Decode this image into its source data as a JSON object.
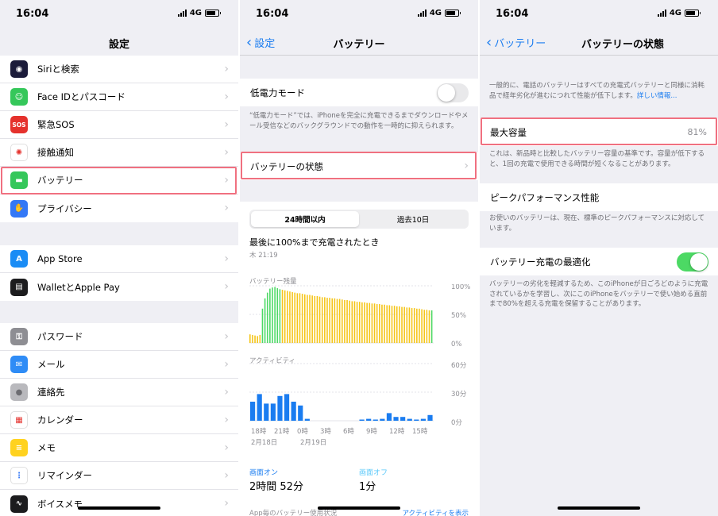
{
  "panel1": {
    "time": "16:04",
    "network": "4G",
    "title": "設定",
    "groups": [
      [
        {
          "label": "Siriと検索",
          "icon": "siri-icon",
          "color": "#1b1b3a"
        },
        {
          "label": "Face IDとパスコード",
          "icon": "face-id-icon",
          "color": "#35c75a"
        },
        {
          "label": "緊急SOS",
          "icon": "sos-icon",
          "color": "#e5322d",
          "glyph": "SOS"
        },
        {
          "label": "接触通知",
          "icon": "exposure-notification-icon",
          "color": "#ffffff"
        },
        {
          "label": "バッテリー",
          "icon": "battery-icon",
          "color": "#35c75a"
        },
        {
          "label": "プライバシー",
          "icon": "hand-icon",
          "color": "#3478f6"
        }
      ],
      [
        {
          "label": "App Store",
          "icon": "app-store-icon",
          "color": "#1a8cf5"
        },
        {
          "label": "WalletとApple Pay",
          "icon": "wallet-icon",
          "color": "#1c1c1e"
        }
      ],
      [
        {
          "label": "パスワード",
          "icon": "key-icon",
          "color": "#8e8e93"
        },
        {
          "label": "メール",
          "icon": "mail-icon",
          "color": "#2f8cf6"
        },
        {
          "label": "連絡先",
          "icon": "contacts-icon",
          "color": "#b9b9bd"
        },
        {
          "label": "カレンダー",
          "icon": "calendar-icon",
          "color": "#ffffff"
        },
        {
          "label": "メモ",
          "icon": "notes-icon",
          "color": "#ffd21f"
        },
        {
          "label": "リマインダー",
          "icon": "reminders-icon",
          "color": "#ffffff"
        },
        {
          "label": "ボイスメモ",
          "icon": "voice-memos-icon",
          "color": "#1c1c1e"
        }
      ]
    ]
  },
  "panel2": {
    "time": "16:04",
    "network": "4G",
    "back": "設定",
    "title": "バッテリー",
    "low_power_label": "低電力モード",
    "low_power_on": false,
    "low_power_note": "“低電力モード”では、iPhoneを完全に充電できるまでダウンロードやメール受信などのバックグラウンドでの動作を一時的に抑えられます。",
    "health_label": "バッテリーの状態",
    "tabs": [
      "24時間以内",
      "過去10日"
    ],
    "last_charge_title": "最後に100%まで充電されたとき",
    "last_charge_time": "木 21:19",
    "level_chart_label": "バッテリー残量",
    "level_ticks": [
      "100%",
      "50%",
      "0%"
    ],
    "activity_chart_label": "アクティビティ",
    "activity_ticks": [
      "60分",
      "30分",
      "0分"
    ],
    "hour_labels": [
      "18時",
      "21時",
      "0時",
      "3時",
      "6時",
      "9時",
      "12時",
      "15時"
    ],
    "date_labels": [
      "2月18日",
      "2月19日"
    ],
    "screen_on_label": "画面オン",
    "screen_on_value": "2時間 52分",
    "screen_off_label": "画面オフ",
    "screen_off_value": "1分",
    "app_usage_label": "App毎のバッテリー使用状況",
    "show_activity_link": "アクティビティを表示"
  },
  "panel3": {
    "time": "16:04",
    "network": "4G",
    "back": "バッテリー",
    "title": "バッテリーの状態",
    "intro": "一般的に、電話のバッテリーはすべての充電式バッテリーと同様に消耗品で経年劣化が進むにつれて性能が低下します。",
    "learn_more": "詳しい情報...",
    "max_capacity_label": "最大容量",
    "max_capacity_value": "81%",
    "max_capacity_note": "これは、新品時と比較したバッテリー容量の基準です。容量が低下すると、1回の充電で使用できる時間が短くなることがあります。",
    "peak_label": "ピークパフォーマンス性能",
    "peak_note": "お使いのバッテリーは、現在、標準のピークパフォーマンスに対応しています。",
    "optimized_label": "バッテリー充電の最適化",
    "optimized_on": true,
    "optimized_note": "バッテリーの劣化を軽減するため、このiPhoneが日ごろどのように充電されているかを学習し、次にこのiPhoneをバッテリーで使い始める直前まで80%を超える充電を保留することがあります。"
  },
  "chart_data": [
    {
      "type": "bar",
      "title": "バッテリー残量",
      "ylim": [
        0,
        100
      ],
      "y_ticks": [
        "100%",
        "50%",
        "0%"
      ],
      "values": [
        15,
        14,
        13,
        12,
        14,
        60,
        78,
        88,
        95,
        97,
        98,
        96,
        94,
        93,
        92,
        91,
        90,
        89,
        88,
        87,
        87,
        86,
        85,
        84,
        84,
        83,
        82,
        82,
        81,
        80,
        80,
        79,
        79,
        78,
        78,
        77,
        77,
        76,
        75,
        75,
        74,
        73,
        73,
        72,
        72,
        71,
        71,
        70,
        70,
        69,
        69,
        68,
        68,
        67,
        67,
        66,
        66,
        65,
        65,
        64,
        64,
        63,
        63,
        62,
        62,
        61,
        61,
        60,
        60,
        59,
        58,
        58,
        57,
        57
      ],
      "charging_bars": [
        5,
        6,
        7,
        8,
        9,
        10,
        11,
        12,
        73
      ]
    },
    {
      "type": "bar",
      "title": "アクティビティ",
      "ylim": [
        0,
        60
      ],
      "y_ticks": [
        "60分",
        "30分",
        "0分"
      ],
      "categories": [
        "18時",
        "21時",
        "0時",
        "3時",
        "6時",
        "9時",
        "12時",
        "15時"
      ],
      "values": [
        20,
        28,
        18,
        18,
        26,
        28,
        20,
        16,
        2,
        0,
        0,
        0,
        0,
        0,
        0,
        0,
        1,
        2,
        1,
        2,
        8,
        4,
        4,
        2,
        1,
        2,
        6
      ]
    }
  ]
}
